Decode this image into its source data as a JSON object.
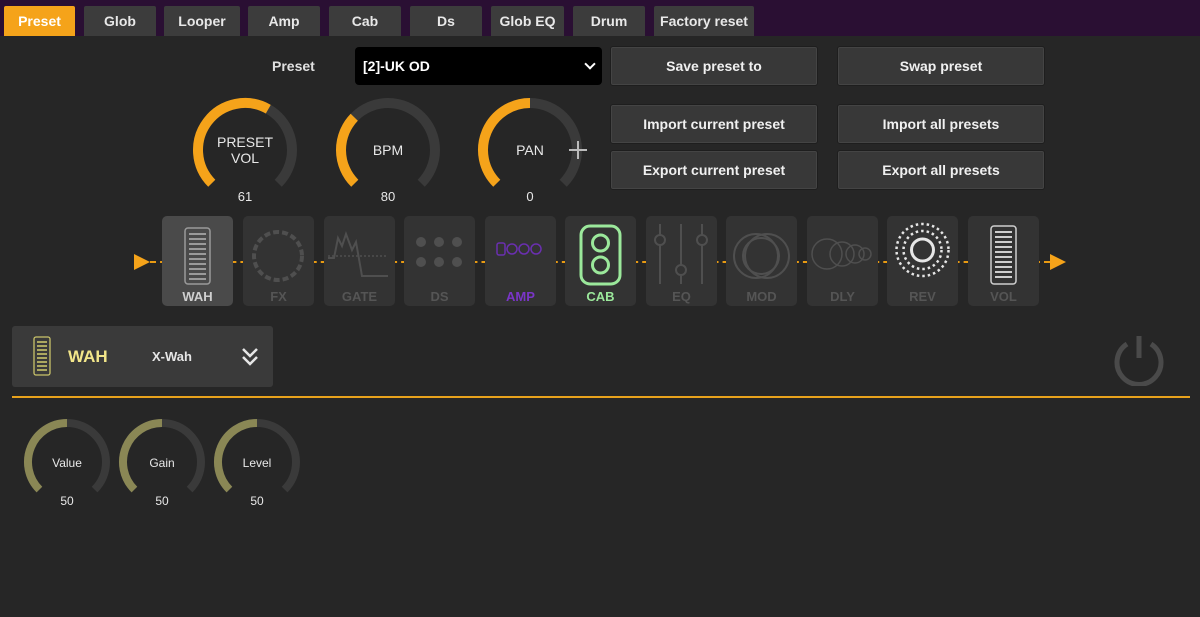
{
  "tabs": [
    {
      "label": "Preset",
      "active": true
    },
    {
      "label": "Glob",
      "active": false
    },
    {
      "label": "Looper",
      "active": false
    },
    {
      "label": "Amp",
      "active": false
    },
    {
      "label": "Cab",
      "active": false
    },
    {
      "label": "Ds",
      "active": false
    },
    {
      "label": "Glob EQ",
      "active": false
    },
    {
      "label": "Drum",
      "active": false
    },
    {
      "label": "Factory reset",
      "active": false
    }
  ],
  "preset": {
    "label": "Preset",
    "selected": "[2]-UK OD"
  },
  "buttons": {
    "save_preset_to": "Save preset to",
    "swap_preset": "Swap preset",
    "import_current": "Import current preset",
    "import_all": "Import all presets",
    "export_current": "Export current preset",
    "export_all": "Export all presets"
  },
  "top_knobs": {
    "preset_vol": {
      "label_line1": "PRESET",
      "label_line2": "VOL",
      "value": "61",
      "fraction": 0.61
    },
    "bpm": {
      "label": "BPM",
      "value": "80",
      "fraction": 0.33
    },
    "pan": {
      "label": "PAN",
      "value": "0",
      "fraction": 0.5
    }
  },
  "chain": {
    "blocks": [
      {
        "label": "WAH",
        "icon": "wah-pedal-icon",
        "state": "selected"
      },
      {
        "label": "FX",
        "icon": "gear-circle-icon",
        "state": "off"
      },
      {
        "label": "GATE",
        "icon": "gate-curve-icon",
        "state": "off"
      },
      {
        "label": "DS",
        "icon": "dots-grid-icon",
        "state": "off"
      },
      {
        "label": "AMP",
        "icon": "amp-knobs-icon",
        "state": "amp"
      },
      {
        "label": "CAB",
        "icon": "speaker-cab-icon",
        "state": "cab"
      },
      {
        "label": "EQ",
        "icon": "eq-sliders-icon",
        "state": "off"
      },
      {
        "label": "MOD",
        "icon": "overlapping-circles-icon",
        "state": "off"
      },
      {
        "label": "DLY",
        "icon": "echo-circles-icon",
        "state": "off"
      },
      {
        "label": "REV",
        "icon": "reverb-rings-icon",
        "state": "on"
      },
      {
        "label": "VOL",
        "icon": "volume-pedal-icon",
        "state": "on"
      }
    ],
    "line_color": "#f5a31a"
  },
  "module": {
    "title": "WAH",
    "model": "X-Wah",
    "title_color": "#f2e68a"
  },
  "params": [
    {
      "label": "Value",
      "value": "50",
      "fraction": 0.5
    },
    {
      "label": "Gain",
      "value": "50",
      "fraction": 0.5
    },
    {
      "label": "Level",
      "value": "50",
      "fraction": 0.5
    }
  ],
  "colors": {
    "accent": "#f5a31a",
    "knob_track": "#3a3a3a",
    "param_arc": "#8a8755",
    "cab_green": "#9be89b",
    "amp_purple": "#8a3fd6"
  }
}
